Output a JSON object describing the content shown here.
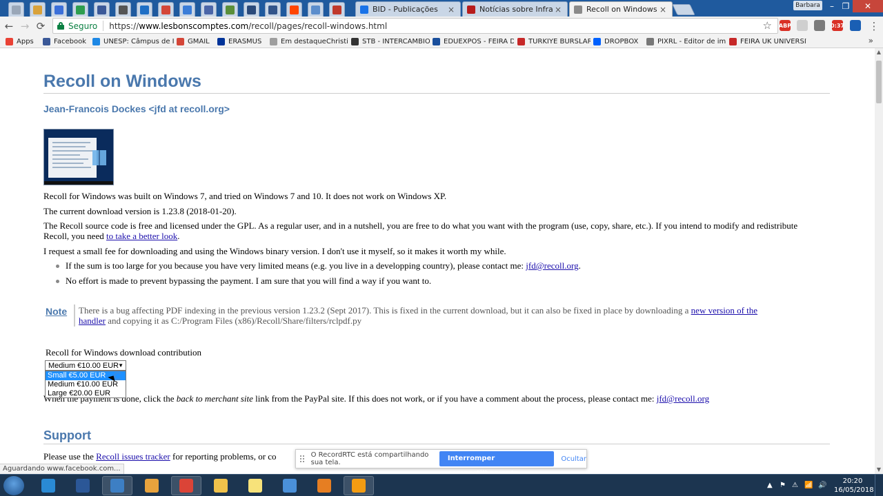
{
  "browser": {
    "pinned_tabs": [
      {
        "icon": "chrome-icon",
        "color": "#9aa7b8"
      },
      {
        "icon": "app-icon",
        "color": "#d9a23b"
      },
      {
        "icon": "docs-icon",
        "color": "#3b6fd9"
      },
      {
        "icon": "play-icon",
        "color": "#2e9e4f"
      },
      {
        "icon": "facebook-icon",
        "color": "#3b5998"
      },
      {
        "icon": "photo-icon",
        "color": "#555555"
      },
      {
        "icon": "outlook-icon",
        "color": "#1f6fc5"
      },
      {
        "icon": "gmail-icon",
        "color": "#d44638"
      },
      {
        "icon": "twitter-icon",
        "color": "#3b7dd8"
      },
      {
        "icon": "e-icon",
        "color": "#4b66a8"
      },
      {
        "icon": "play-icon",
        "color": "#5a8f3a"
      },
      {
        "icon": "x-icon",
        "color": "#2b4a7a"
      },
      {
        "icon": "pen-icon",
        "color": "#33558a"
      },
      {
        "icon": "reddit-icon",
        "color": "#ff4500"
      },
      {
        "icon": "drop-icon",
        "color": "#5c8ecc"
      },
      {
        "icon": "headphones-icon",
        "color": "#c0392b"
      }
    ],
    "tabs": [
      {
        "title": "BID - Publicações",
        "close": "×",
        "color": "#1a73e8",
        "active": false
      },
      {
        "title": "Notícias sobre Infraestrutura",
        "close": "×",
        "color": "#b71c1c",
        "active": false
      },
      {
        "title": "Recoll on Windows",
        "close": "×",
        "color": "#8a8a8a",
        "active": true
      }
    ],
    "profile": "Barbara",
    "window_controls": {
      "minimize": "–",
      "restore": "❐",
      "close": "✕"
    },
    "back": "←",
    "forward": "→",
    "reload": "⟳",
    "secure_label": "Seguro",
    "url_prefix": "https://",
    "url_host": "www.lesbonscomptes.com",
    "url_path": "/recoll/pages/recoll-windows.html",
    "star": "☆",
    "extensions": [
      {
        "icon": "adblock-icon",
        "color": "#d93025",
        "badge": "ABP"
      },
      {
        "icon": "puzzle-icon",
        "color": "#cfcfcf",
        "badge": ""
      },
      {
        "icon": "gear-icon",
        "color": "#7a7a7a",
        "badge": ""
      },
      {
        "icon": "recordrtc-icon",
        "color": "#d93025",
        "badge": "0:37"
      },
      {
        "icon": "bookmark-icon",
        "color": "#1a5fb4",
        "badge": ""
      }
    ],
    "menu": "⋮",
    "bookmarks": [
      {
        "label": "Apps",
        "icon": "apps-icon",
        "color": "#e94235"
      },
      {
        "label": "Facebook",
        "icon": "facebook-icon",
        "color": "#3b5998"
      },
      {
        "label": "UNESP: Câmpus de I",
        "icon": "unesp-icon",
        "color": "#1e88e5"
      },
      {
        "label": "GMAIL",
        "icon": "gmail-icon",
        "color": "#d44638"
      },
      {
        "label": "ERASMUS",
        "icon": "eu-flag-icon",
        "color": "#003399"
      },
      {
        "label": "Em destaqueChristin",
        "icon": "page-icon",
        "color": "#9e9e9e"
      },
      {
        "label": "STB - INTERCAMBIO",
        "icon": "stb-icon",
        "color": "#333333"
      },
      {
        "label": "EDUEXPOS - FEIRA D",
        "icon": "edu-icon",
        "color": "#1a4f9c"
      },
      {
        "label": "TURKIYE BURSLARI",
        "icon": "turkey-icon",
        "color": "#c62828"
      },
      {
        "label": "DROPBOX",
        "icon": "dropbox-icon",
        "color": "#0061fe"
      },
      {
        "label": "PIXRL - Editor de im",
        "icon": "pixlr-icon",
        "color": "#777777"
      },
      {
        "label": "FEIRA UK UNIVERSIT",
        "icon": "uk-icon",
        "color": "#c62828"
      }
    ],
    "bookmarks_more": "»",
    "status": "Aguardando www.facebook.com..."
  },
  "page": {
    "title": "Recoll on Windows",
    "author": "Jean-Francois Dockes <jfd at recoll.org>",
    "p1": "Recoll for Windows was built on Windows 7, and tried on Windows 7 and 10. It does not work on Windows XP.",
    "p2": "The current download version is 1.23.8 (2018-01-20).",
    "p3": "The Recoll source code is free and licensed under the GPL. As a regular user, and in a nutshell, you are free to do what you want with the program (use, copy, share, etc.). If you intend to modify and redistribute Recoll, you need ",
    "p3_link": "to take a better look",
    "p3_end": ".",
    "p4": "I request a small fee for downloading and using the Windows binary version. I don't use it myself, so it makes it worth my while.",
    "b1": "If the sum is too large for you because you have very limited means (e.g. you live in a developping country), please contact me: ",
    "b1_link": "jfd@recoll.org",
    "b1_end": ".",
    "b2": "No effort is made to prevent bypassing the payment. I am sure that you will find a way if you want to.",
    "note_label": "Note",
    "note_text": "There is a bug affecting PDF indexing in the previous version 1.23.2 (Sept 2017). This is fixed in the current download, but it can also be fixed in place by downloading a ",
    "note_link": "new version of the handler",
    "note_end": " and copying it as C:/Program Files (x86)/Recoll/Share/filters/rclpdf.py",
    "contrib_label": "Recoll for Windows download contribution",
    "select_value": "Medium €10.00 EUR",
    "select_arrow": "▼",
    "options": [
      "Small €5.00 EUR",
      "Medium €10.00 EUR",
      "Large €20.00 EUR"
    ],
    "payment_pre": "When the payment is done, click the ",
    "payment_em": "back to merchant site",
    "payment_mid": " link from the PayPal site. If this does not work, or if you have a comment about the process, please contact me: ",
    "payment_link": "jfd@recoll.org",
    "support_heading": "Support",
    "support_pre": "Please use the ",
    "support_link": "Recoll issues tracker",
    "support_mid": " for reporting problems, or co"
  },
  "share_bar": {
    "text": "O RecordRTC está compartilhando sua tela.",
    "stop": "Interromper compartilhamento",
    "hide": "Ocultar"
  },
  "taskbar": {
    "apps": [
      {
        "icon": "internet-explorer-icon",
        "color": "#2a8ad4",
        "open": false
      },
      {
        "icon": "word-icon",
        "color": "#2b5797",
        "open": false
      },
      {
        "icon": "control-panel-icon",
        "color": "#3d7fc4",
        "open": true
      },
      {
        "icon": "media-player-icon",
        "color": "#e8a33d",
        "open": false
      },
      {
        "icon": "chrome-icon",
        "color": "#db4437",
        "open": true
      },
      {
        "icon": "folder-icon",
        "color": "#f0c24b",
        "open": false
      },
      {
        "icon": "photo-viewer-icon",
        "color": "#f7e27a",
        "open": false
      },
      {
        "icon": "document-icon",
        "color": "#4a90d9",
        "open": false
      },
      {
        "icon": "butterfly-icon",
        "color": "#e67e22",
        "open": false
      },
      {
        "icon": "editor-icon",
        "color": "#f39c12",
        "open": true
      }
    ],
    "tray": [
      "▲",
      "⚑",
      "⚠",
      "📶",
      "🔊"
    ],
    "time": "20:20",
    "date": "16/05/2018"
  }
}
